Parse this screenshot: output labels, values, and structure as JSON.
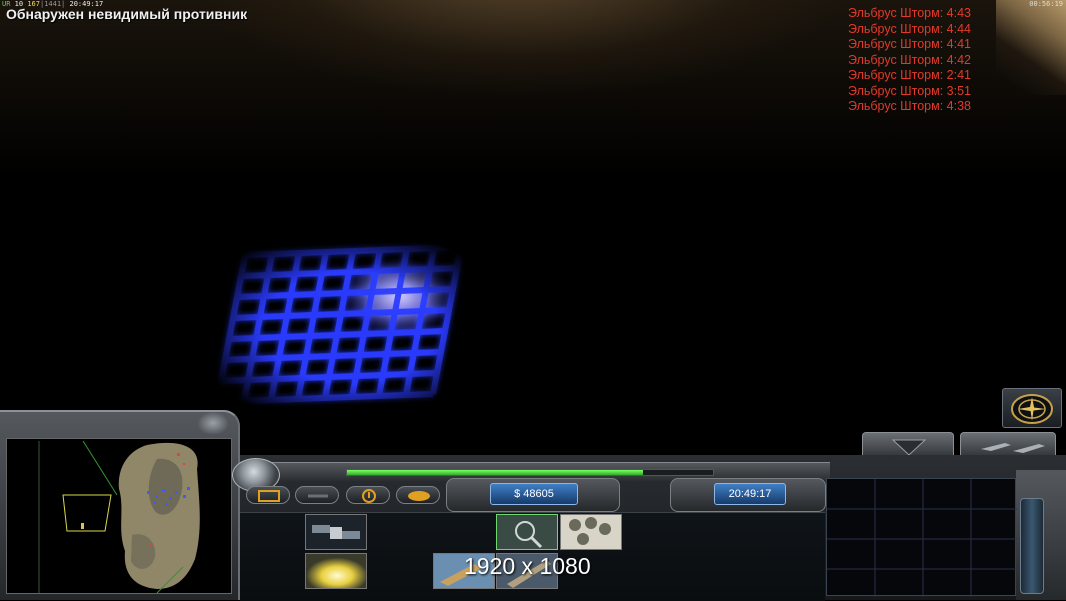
{
  "hud_top": {
    "stats": {
      "prefix": "UR",
      "a": "10",
      "b": "167",
      "c": "1441",
      "time": "20:49:17"
    },
    "alert": "Обнаружен невидимый противник",
    "system_clock": "00:56:19"
  },
  "storm_timers": [
    "Эльбрус Шторм: 4:43",
    "Эльбрус Шторм: 4:44",
    "Эльбрус Шторм: 4:41",
    "Эльбрус Шторм: 4:42",
    "Эльбрус Шторм: 2:41",
    "Эльбрус Шторм: 3:51",
    "Эльбрус Шторм: 4:38"
  ],
  "sidebar": {
    "money": "$ 48605",
    "game_time": "20:49:17",
    "power_fraction": 0.81
  },
  "overlay": {
    "resolution_text": "1920 x 1080"
  },
  "build_icons": [
    "satellite-icon",
    "lightning-strike-icon",
    "radar-scan-icon",
    "paradrop-icon",
    "missile-icon",
    "artillery-icon"
  ],
  "colors": {
    "storm_text": "#e23a2a",
    "power_bar": "#4fdc3a",
    "readout_blue": "#2f6cb3",
    "grid_blue": "#2a3cff"
  }
}
